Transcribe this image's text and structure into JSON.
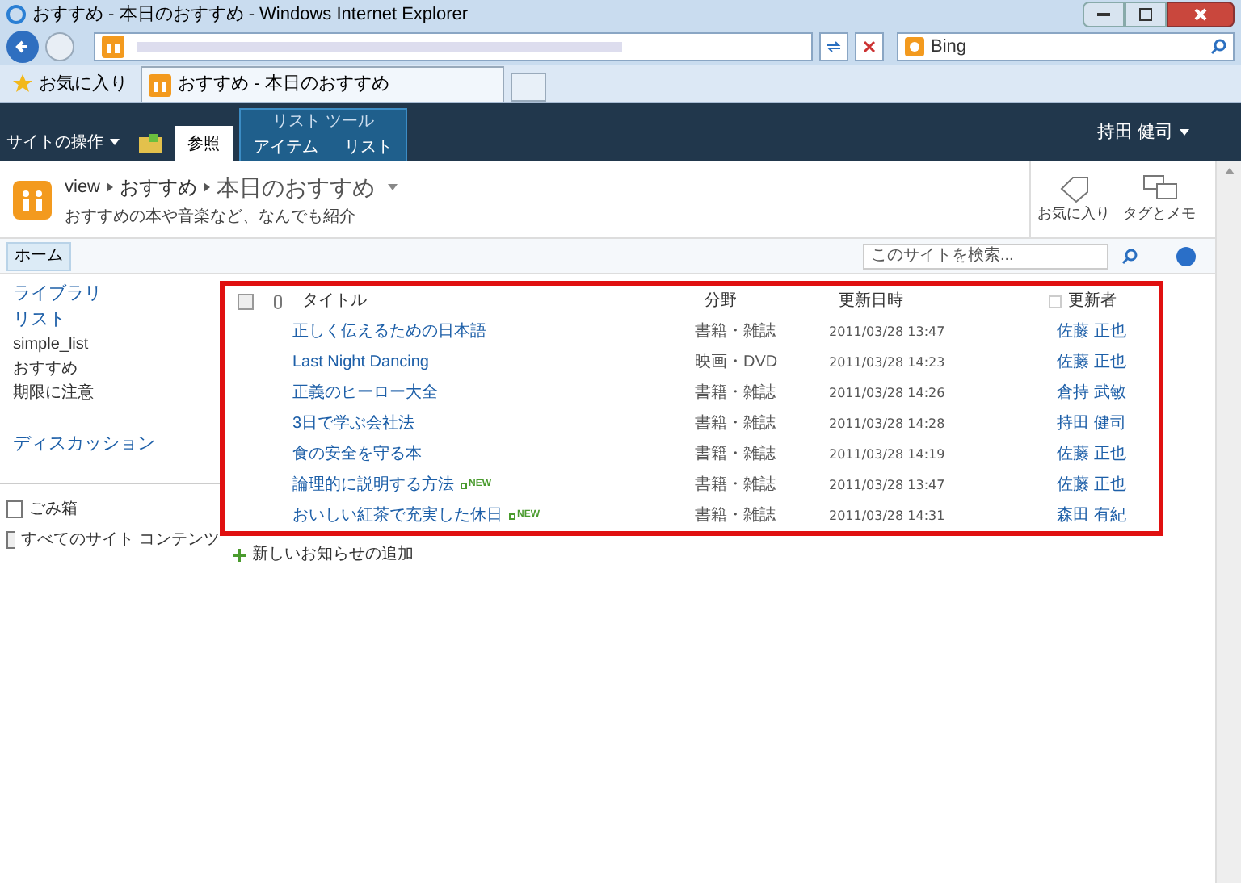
{
  "window": {
    "title": "おすすめ - 本日のおすすめ - Windows Internet Explorer"
  },
  "search_engine": {
    "placeholder": "Bing"
  },
  "favorites": {
    "label": "お気に入り"
  },
  "browser_tab": {
    "title": "おすすめ - 本日のおすすめ"
  },
  "ribbon": {
    "site_actions": "サイトの操作",
    "tool_group": "リスト ツール",
    "tabs": [
      {
        "label": "参照",
        "selected": true
      },
      {
        "label": "アイテム",
        "selected": false
      },
      {
        "label": "リスト",
        "selected": false
      }
    ],
    "user": "持田 健司"
  },
  "header": {
    "breadcrumb": [
      "view",
      "おすすめ",
      "本日のおすすめ"
    ],
    "description": "おすすめの本や音楽など、なんでも紹介",
    "actions": [
      {
        "kind": "tag",
        "label": "お気に入り"
      },
      {
        "kind": "note",
        "label": "タグとメモ"
      }
    ]
  },
  "topnav": {
    "home": "ホーム",
    "search": {
      "placeholder": "このサイトを検索..."
    }
  },
  "quicklaunch": [
    {
      "label": "ライブラリ",
      "kind": "heading"
    },
    {
      "label": "リスト",
      "kind": "heading"
    },
    {
      "label": "simple_list",
      "kind": "item"
    },
    {
      "label": "おすすめ",
      "kind": "item"
    },
    {
      "label": "期限に注意",
      "kind": "item"
    },
    {
      "label": "ディスカッション",
      "kind": "heading"
    }
  ],
  "bottom_links": [
    {
      "kind": "recycle",
      "label": "ごみ箱"
    },
    {
      "kind": "content",
      "label": "すべてのサイト コンテンツ"
    }
  ],
  "table": {
    "select_all": {
      "checked": false
    },
    "editor_filter": {
      "checked": false
    },
    "columns": [
      "タイトル",
      "分野",
      "更新日時",
      "更新者"
    ],
    "rows": [
      {
        "title": "正しく伝えるための日本語",
        "category": "書籍・雑誌",
        "modified": "2011/03/28 13:47",
        "editor": "佐藤 正也"
      },
      {
        "title": "Last Night Dancing",
        "category": "映画・DVD",
        "modified": "2011/03/28 14:23",
        "editor": "佐藤 正也"
      },
      {
        "title": "正義のヒーロー大全",
        "category": "書籍・雑誌",
        "modified": "2011/03/28 14:26",
        "editor": "倉持 武敏"
      },
      {
        "title": "3日で学ぶ会社法",
        "category": "書籍・雑誌",
        "modified": "2011/03/28 14:28",
        "editor": "持田 健司"
      },
      {
        "title": "食の安全を守る本",
        "category": "書籍・雑誌",
        "modified": "2011/03/28 14:19",
        "editor": "佐藤 正也"
      },
      {
        "title": "論理的に説明する方法",
        "category": "書籍・雑誌",
        "modified": "2011/03/28 13:47",
        "editor": "佐藤 正也",
        "badge": "NEW"
      },
      {
        "title": "おいしい紅茶で充実した休日",
        "category": "書籍・雑誌",
        "modified": "2011/03/28 14:31",
        "editor": "森田 有紀",
        "badge": "NEW"
      }
    ],
    "add_link": "新しいお知らせの追加"
  }
}
